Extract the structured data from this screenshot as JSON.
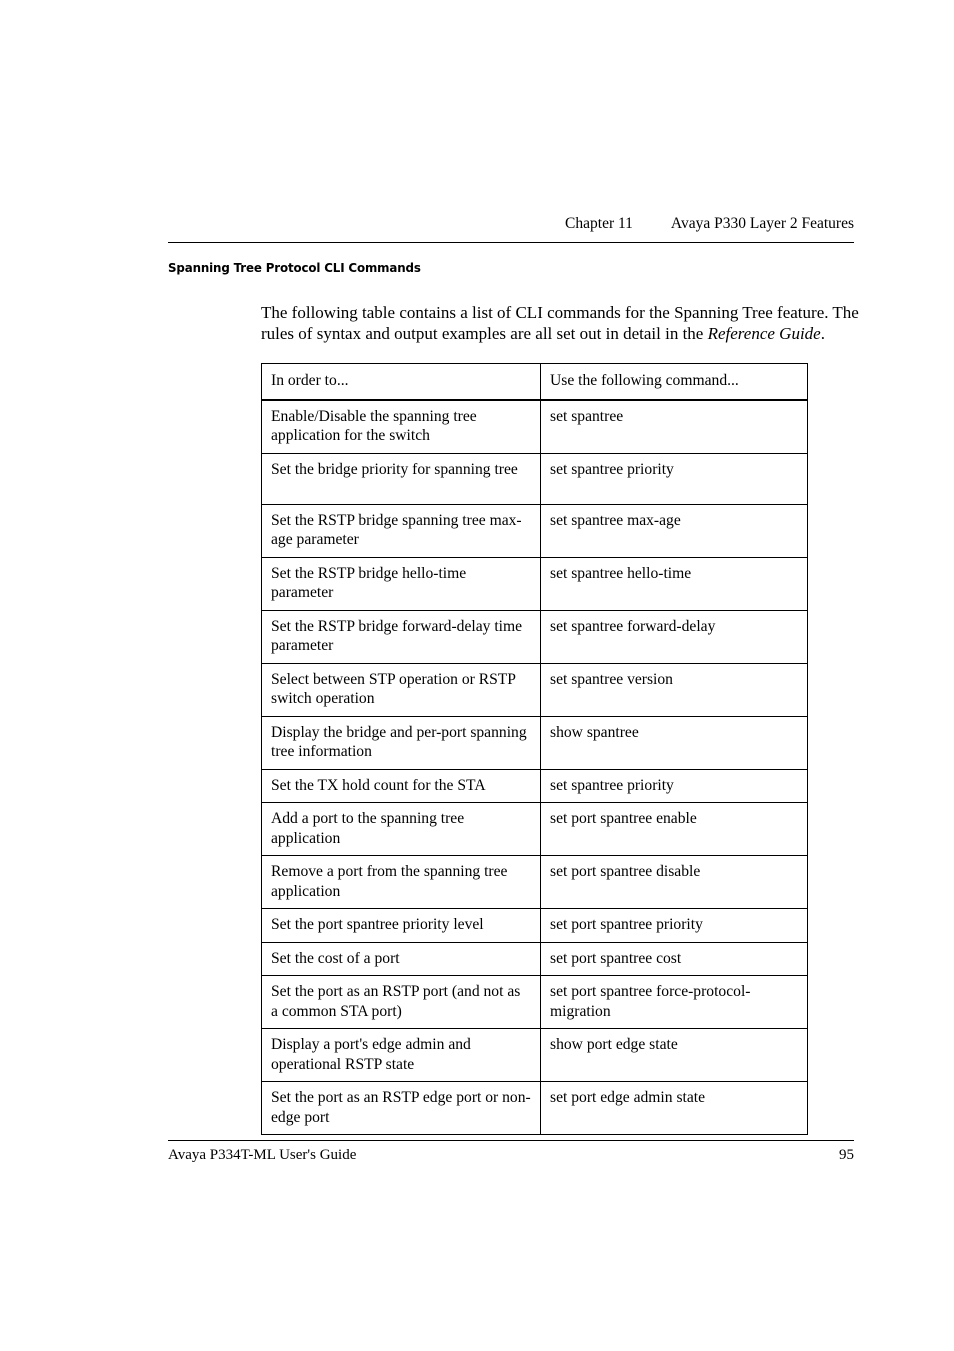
{
  "header": {
    "chapter": "Chapter 11",
    "chapter_title": "Avaya P330 Layer 2 Features"
  },
  "section": {
    "heading": "Spanning Tree Protocol CLI Commands",
    "intro_part1": "The following table contains a list of CLI commands for the Spanning Tree feature. The rules of syntax and output examples are all set out in detail in the ",
    "intro_italic": "Reference Guide",
    "intro_part2": "."
  },
  "table": {
    "columns": [
      "In order to...",
      "Use the following command..."
    ],
    "rows": [
      {
        "action": "Enable/Disable the spanning tree application for the switch",
        "command": "set spantree",
        "lines": 2
      },
      {
        "action": "Set the bridge priority for spanning tree",
        "command": "set spantree priority",
        "lines": 2
      },
      {
        "action": "Set the RSTP bridge spanning tree max-age parameter",
        "command": "set spantree max-age",
        "lines": 2
      },
      {
        "action": "Set the RSTP bridge hello-time parameter",
        "command": "set spantree hello-time",
        "lines": 2
      },
      {
        "action": "Set the RSTP bridge forward-delay time parameter",
        "command": "set spantree forward-delay",
        "lines": 2
      },
      {
        "action": "Select between STP operation or RSTP switch operation",
        "command": "set spantree version",
        "lines": 2
      },
      {
        "action": "Display the bridge and per-port spanning tree information",
        "command": "show spantree",
        "lines": 2
      },
      {
        "action": "Set the TX hold count for the STA",
        "command": "set spantree priority",
        "lines": 1
      },
      {
        "action": "Add a port to the spanning tree application",
        "command": "set port spantree enable",
        "lines": 2
      },
      {
        "action": "Remove a port from the spanning tree application",
        "command": "set port spantree disable",
        "lines": 2
      },
      {
        "action": "Set the port spantree priority level",
        "command": "set port spantree priority",
        "lines": 1
      },
      {
        "action": "Set the cost of a port",
        "command": "set port spantree cost",
        "lines": 1
      },
      {
        "action": "Set the port as an RSTP port (and not as a common STA port)",
        "command": "set port spantree force-protocol-migration",
        "lines": 2
      },
      {
        "action": "Display a port's edge admin and operational RSTP state",
        "command": "show port edge state",
        "lines": 2
      },
      {
        "action": "Set the port as an RSTP edge port or non-edge port",
        "command": "set port edge admin state",
        "lines": 2
      }
    ]
  },
  "footer": {
    "doc_title": "Avaya P334T-ML User's Guide",
    "page_number": "95"
  }
}
